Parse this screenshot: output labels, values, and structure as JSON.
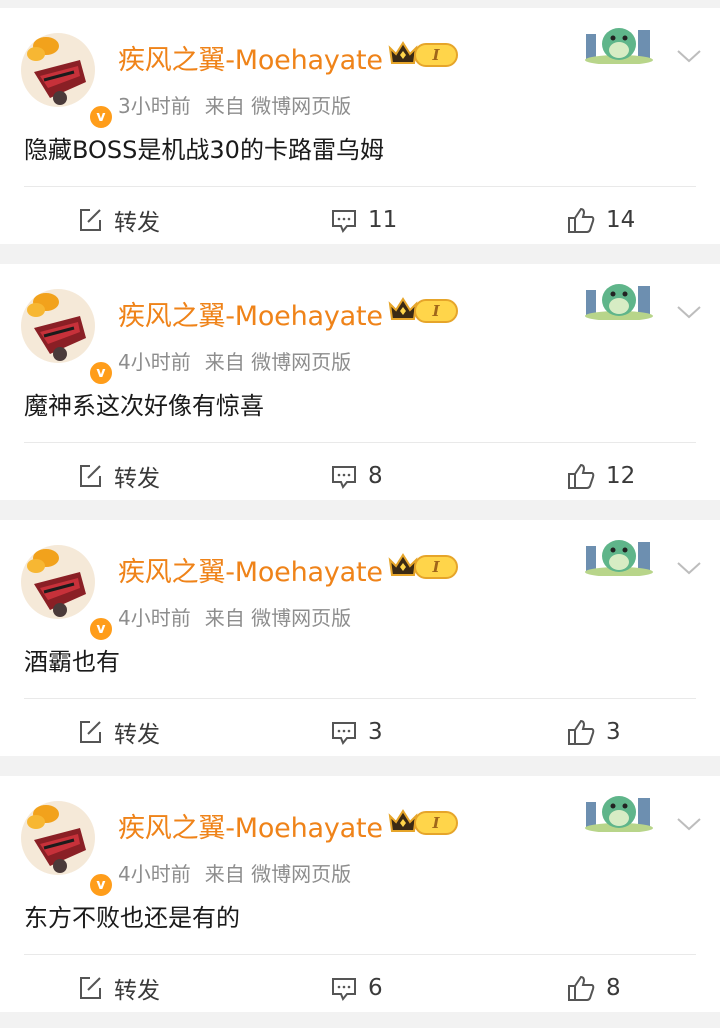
{
  "feed": {
    "comments": [
      {
        "username": "疾风之翼-Moehayate",
        "level": "I",
        "verified_mark": "v",
        "time": "3小时前",
        "source": "来自 微博网页版",
        "content": "隐藏BOSS是机战30的卡路雷乌姆",
        "share_label": "转发",
        "comment_count": "11",
        "like_count": "14"
      },
      {
        "username": "疾风之翼-Moehayate",
        "level": "I",
        "verified_mark": "v",
        "time": "4小时前",
        "source": "来自 微博网页版",
        "content": "魔神系这次好像有惊喜",
        "share_label": "转发",
        "comment_count": "8",
        "like_count": "12"
      },
      {
        "username": "疾风之翼-Moehayate",
        "level": "I",
        "verified_mark": "v",
        "time": "4小时前",
        "source": "来自 微博网页版",
        "content": "酒霸也有",
        "share_label": "转发",
        "comment_count": "3",
        "like_count": "3"
      },
      {
        "username": "疾风之翼-Moehayate",
        "level": "I",
        "verified_mark": "v",
        "time": "4小时前",
        "source": "来自 微博网页版",
        "content": "东方不败也还是有的",
        "share_label": "转发",
        "comment_count": "6",
        "like_count": "8"
      }
    ]
  },
  "colors": {
    "username": "#ef8319",
    "meta": "#8d8d8d",
    "content": "#1a1a1a",
    "badge": "#ff9d1a",
    "level_bg": "#ffd54a",
    "background": "#f2f2f2"
  },
  "icons": {
    "share": "share-edit-icon",
    "comment": "comment-bubble-icon",
    "like": "thumbs-up-icon",
    "more": "chevron-down-icon",
    "crown": "crown-icon",
    "sticker": "dinosaur-sticker-icon"
  }
}
